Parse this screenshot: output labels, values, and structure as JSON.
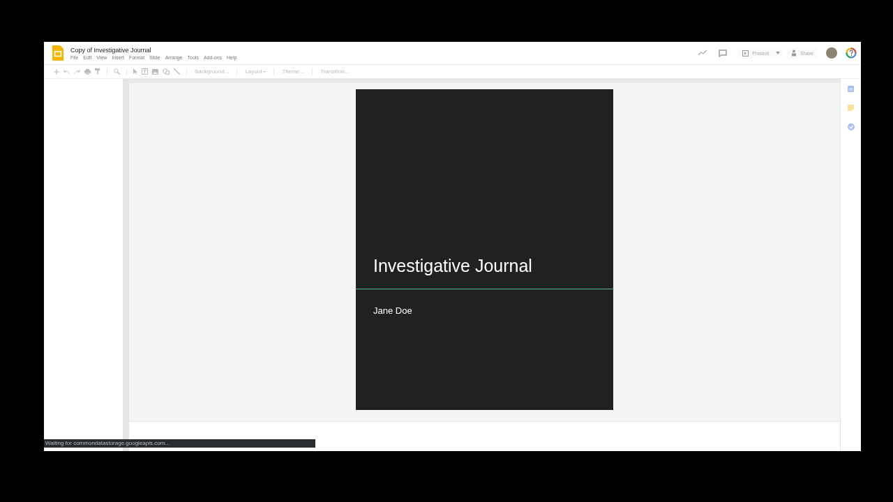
{
  "window": {
    "title": "Copy of Investigative Journal"
  },
  "menu": [
    "File",
    "Edit",
    "View",
    "Insert",
    "Format",
    "Slide",
    "Arrange",
    "Tools",
    "Add-ons",
    "Help"
  ],
  "toolbar": [
    {
      "label": "Background...",
      "kind": "plain"
    },
    {
      "label": "Layout",
      "kind": "dropdown"
    },
    {
      "label": "Theme...",
      "kind": "plain"
    },
    {
      "label": "Transition...",
      "kind": "plain"
    }
  ],
  "header_actions": {
    "present": "Present",
    "share": "Share"
  },
  "slide": {
    "title": "Investigative Journal",
    "subtitle": "Jane Doe"
  },
  "status_bar": "Waiting for commondatastorage.googleapis.com..."
}
